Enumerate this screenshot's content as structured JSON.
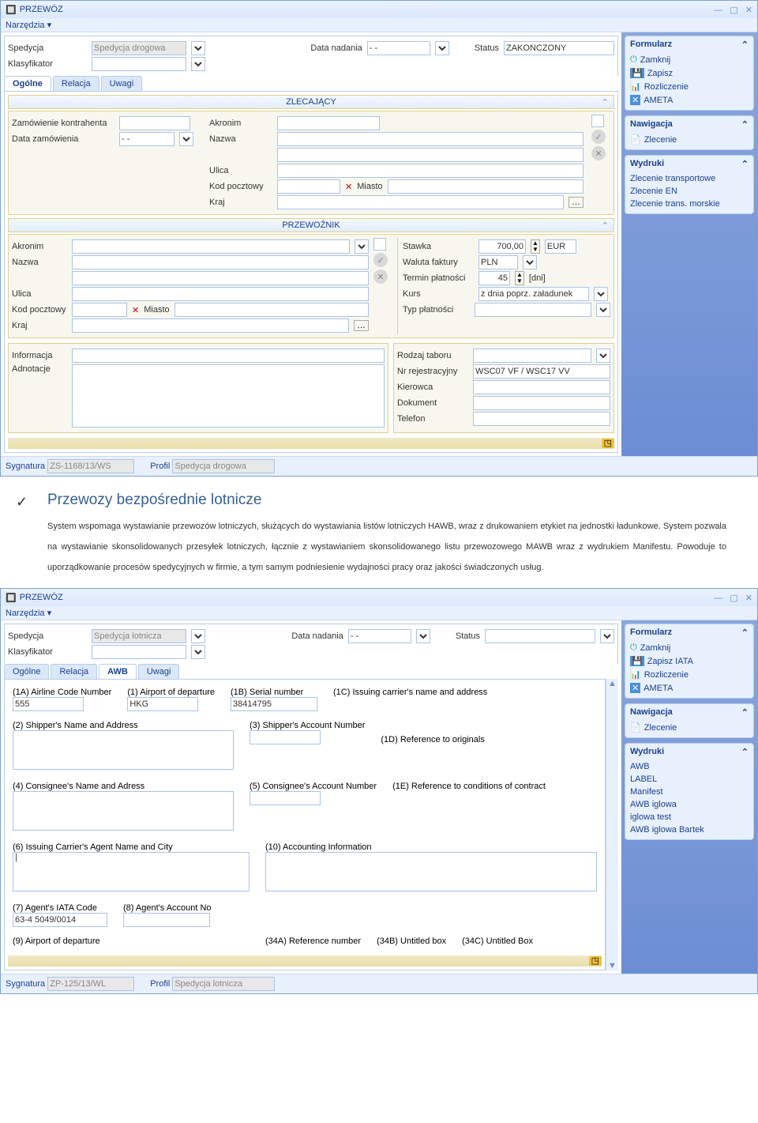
{
  "app1": {
    "title": "PRZEWÓZ",
    "menu": "Narzędzia",
    "header": {
      "spedycja_lbl": "Spedycja",
      "spedycja_val": "Spedycja drogowa",
      "data_nadania_lbl": "Data nadania",
      "data_nadania_val": "- -",
      "status_lbl": "Status",
      "status_val": "ZAKOŃCZONY",
      "klasyfikator_lbl": "Klasyfikator"
    },
    "tabs": [
      "Ogólne",
      "Relacja",
      "Uwagi"
    ],
    "zlecajacy": {
      "title": "ZLECAJĄCY",
      "zam_lbl": "Zamówienie kontrahenta",
      "data_zam_lbl": "Data zamówienia",
      "data_zam_val": "- -",
      "akronim_lbl": "Akronim",
      "nazwa_lbl": "Nazwa",
      "ulica_lbl": "Ulica",
      "kod_lbl": "Kod pocztowy",
      "miasto_lbl": "Miasto",
      "kraj_lbl": "Kraj"
    },
    "przewoznik": {
      "title": "PRZEWOŹNIK",
      "akronim_lbl": "Akronim",
      "nazwa_lbl": "Nazwa",
      "ulica_lbl": "Ulica",
      "kod_lbl": "Kod pocztowy",
      "miasto_lbl": "Miasto",
      "kraj_lbl": "Kraj",
      "informacja_lbl": "Informacja",
      "adnotacje_lbl": "Adnotacje",
      "stawka_lbl": "Stawka",
      "stawka_val": "700,00",
      "stawka_cur": "EUR",
      "waluta_lbl": "Waluta faktury",
      "waluta_val": "PLN",
      "termin_lbl": "Termin płatności",
      "termin_val": "45",
      "termin_unit": "[dni]",
      "kurs_lbl": "Kurs",
      "kurs_val": "z dnia poprz. załadunek",
      "typ_lbl": "Typ płatności",
      "rodzaj_lbl": "Rodzaj taboru",
      "nrrej_lbl": "Nr rejestracyjny",
      "nrrej_val": "WSC07 VF / WSC17 VV",
      "kierowca_lbl": "Kierowca",
      "dokument_lbl": "Dokument",
      "telefon_lbl": "Telefon"
    },
    "status": {
      "sygnatura_lbl": "Sygnatura",
      "sygnatura_val": "ZS-1168/13/WS",
      "profil_lbl": "Profil",
      "profil_val": "Spedycja drogowa"
    },
    "side": {
      "formularz": "Formularz",
      "zamknij": "Zamknij",
      "zapisz": "Zapisz",
      "rozliczenie": "Rozliczenie",
      "ameta": "AMETA",
      "nawigacja": "Nawigacja",
      "zlecenie": "Zlecenie",
      "wydruki": "Wydruki",
      "w1": "Zlecenie transportowe",
      "w2": "Zlecenie EN",
      "w3": "Zlecenie trans. morskie"
    }
  },
  "para": {
    "title": "Przewozy bezpośrednie lotnicze",
    "body": "System wspomaga wystawianie przewozów lotniczych, służących do wystawiania listów lotniczych HAWB, wraz z drukowaniem etykiet na jednostki ładunkowe. System pozwala na wystawianie skonsolidowanych przesyłek lotniczych, łącznie z wystawianiem skonsolidowanego listu przewozowego MAWB wraz z wydrukiem Manifestu. Powoduje to uporządkowanie procesów spedycyjnych w firmie, a tym samym podniesienie wydajności pracy oraz jakości świadczonych usług."
  },
  "app2": {
    "title": "PRZEWÓZ",
    "menu": "Narzędzia",
    "header": {
      "spedycja_lbl": "Spedycja",
      "spedycja_val": "Spedycja lotnicza",
      "data_nadania_lbl": "Data nadania",
      "data_nadania_val": "- -",
      "status_lbl": "Status",
      "klasyfikator_lbl": "Klasyfikator"
    },
    "tabs": [
      "Ogólne",
      "Relacja",
      "AWB",
      "Uwagi"
    ],
    "awb": {
      "f1a": "(1A) Airline Code Number",
      "f1a_val": "555",
      "f1": "(1) Airport of departure",
      "f1_val": "HKG",
      "f1b": "(1B) Serial number",
      "f1b_val": "38414795",
      "f1c": "(1C) Issuing carrier's name and address",
      "f2": "(2) Shipper's Name and Address",
      "f3": "(3) Shipper's Account Number",
      "f1d": "(1D) Reference to originals",
      "f4": "(4) Consignee's Name and Adress",
      "f5": "(5) Consignee's Account Number",
      "f1e": "(1E) Reference to conditions of contract",
      "f6": "(6) Issuing Carrier's Agent Name and City",
      "f10": "(10) Accounting Information",
      "f7": "(7) Agent's IATA Code",
      "f7_val": "63-4 5049/0014",
      "f8": "(8) Agent's Account No",
      "f9": "(9) Airport of departure",
      "f34a": "(34A) Reference number",
      "f34b": "(34B) Untitled box",
      "f34c": "(34C) Untitled Box"
    },
    "status": {
      "sygnatura_lbl": "Sygnatura",
      "sygnatura_val": "ZP-125/13/WL",
      "profil_lbl": "Profil",
      "profil_val": "Spedycja lotnicza"
    },
    "side": {
      "formularz": "Formularz",
      "zamknij": "Zamknij",
      "zapisz": "Zapisz IATA",
      "rozliczenie": "Rozliczenie",
      "ameta": "AMETA",
      "nawigacja": "Nawigacja",
      "zlecenie": "Zlecenie",
      "wydruki": "Wydruki",
      "w1": "AWB",
      "w2": "LABEL",
      "w3": "Manifest",
      "w4": "AWB iglowa",
      "w5": "iglowa test",
      "w6": "AWB iglowa Bartek"
    }
  }
}
